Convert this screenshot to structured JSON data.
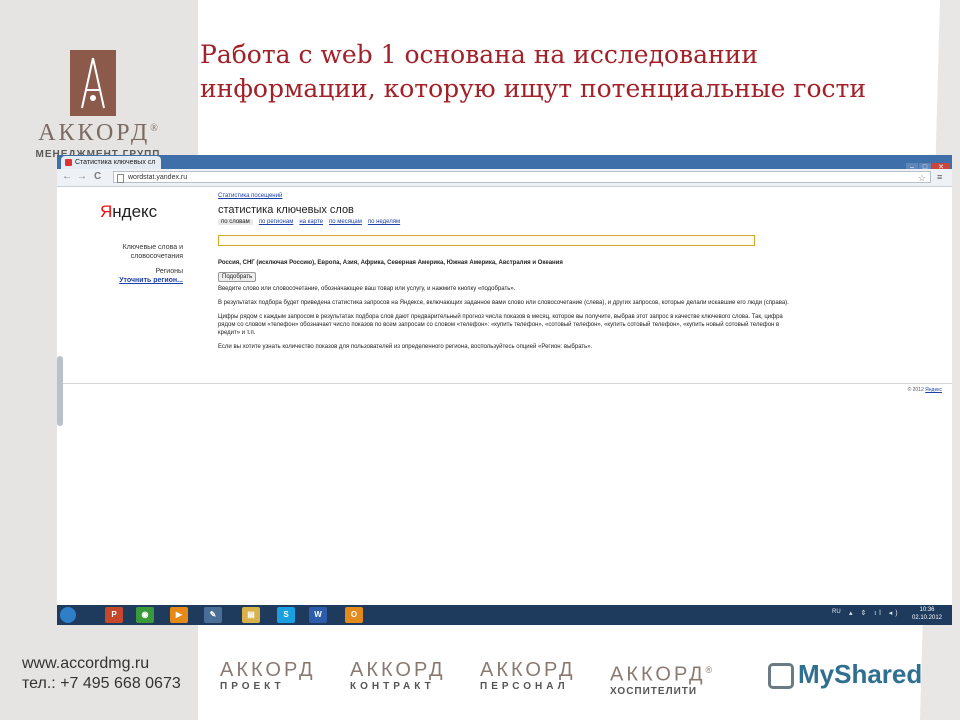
{
  "slide": {
    "title": "Работа с web 1 основана на исследовании информации, которую ищут потенциальные гости",
    "logo": {
      "main": "АККОРД",
      "reg": "®",
      "sub": "МЕНЕДЖМЕНТ ГРУПП"
    }
  },
  "browser": {
    "tab_title": "Статистика ключевых сл",
    "url": "wordstat.yandex.ru",
    "nav_back": "←",
    "nav_forward": "→",
    "nav_reload": "C",
    "win_minimize": "‒",
    "win_maximize": "□",
    "win_close": "✕",
    "star": "☆",
    "menu": "≡"
  },
  "yandex": {
    "logo_first": "Я",
    "logo_rest": "ндекс",
    "left_nav": {
      "keywords": "Ключевые слова и словосочетания",
      "regions": "Регионы",
      "refine": "Уточнить регион..."
    },
    "visits_link": "Статистика посещений",
    "heading": "статистика ключевых слов",
    "subnav": [
      "по словам",
      "по регионам",
      "на карте",
      "по месяцам",
      "по неделям"
    ],
    "regions_text": "Россия, СНГ (исключая Россию), Европа, Азия, Африка, Северная Америка, Южная Америка, Австралия и Океания",
    "button": "Подобрать",
    "paragraphs": [
      "Введите слово или словосочетание, обозначающее ваш товар или услугу, и нажмите кнопку «подобрать».",
      "В результатах подбора будет приведена статистика запросов на Яндексе, включающих заданное вами слово или словосочетание (слева), и других запросов, которые делали искавшие его люди (справа).",
      "Цифры рядом с каждым запросом в результатах подбора слов дают предварительный прогноз числа показов в месяц, которое вы получите, выбрав этот запрос в качестве ключевого слова. Так, цифра рядом со словом «телефон» обозначает число показов по всем запросам со словом «телефон»: «купить телефон», «сотовый телефон», «купить сотовый телефон», «купить новый сотовый телефон в кредит» и т.п.",
      "Если вы хотите узнать количество показов для пользователей из определенного региона, воспользуйтесь опцией «Регион: выбрать»."
    ],
    "copyright": "© 2012",
    "copyright_link": "Яндекс"
  },
  "taskbar": {
    "lang": "RU",
    "tray": "▴ ⇕ ıl ◂)",
    "time": "10:36",
    "date": "02.10.2012",
    "apps": [
      {
        "name": "powerpoint",
        "label": "P",
        "color": "#c5472c"
      },
      {
        "name": "chrome",
        "label": "◉",
        "color": "#3a9a3a"
      },
      {
        "name": "media-player",
        "label": "▶",
        "color": "#e58a16"
      },
      {
        "name": "tool",
        "label": "✎",
        "color": "#4a6e96"
      },
      {
        "name": "explorer",
        "label": "▤",
        "color": "#d8b14a"
      },
      {
        "name": "skype",
        "label": "S",
        "color": "#1aa0e0"
      },
      {
        "name": "word",
        "label": "W",
        "color": "#2c5caa"
      },
      {
        "name": "outlook",
        "label": "O",
        "color": "#e28a1c"
      }
    ]
  },
  "footer": {
    "website": "www.accordmg.ru",
    "phone": "тел.: +7 495 668 0673",
    "logos": [
      {
        "word": "АККОРД",
        "sub": "ПРОЕКТ"
      },
      {
        "word": "АККОРД",
        "sub": "КОНТРАКТ"
      },
      {
        "word": "АККОРД",
        "sub": "ПЕРСОНАЛ"
      },
      {
        "word": "АККОРД",
        "sub": "ХОСПИТЕЛИТИ",
        "reg": "®"
      }
    ],
    "myshared": "MyShared"
  }
}
